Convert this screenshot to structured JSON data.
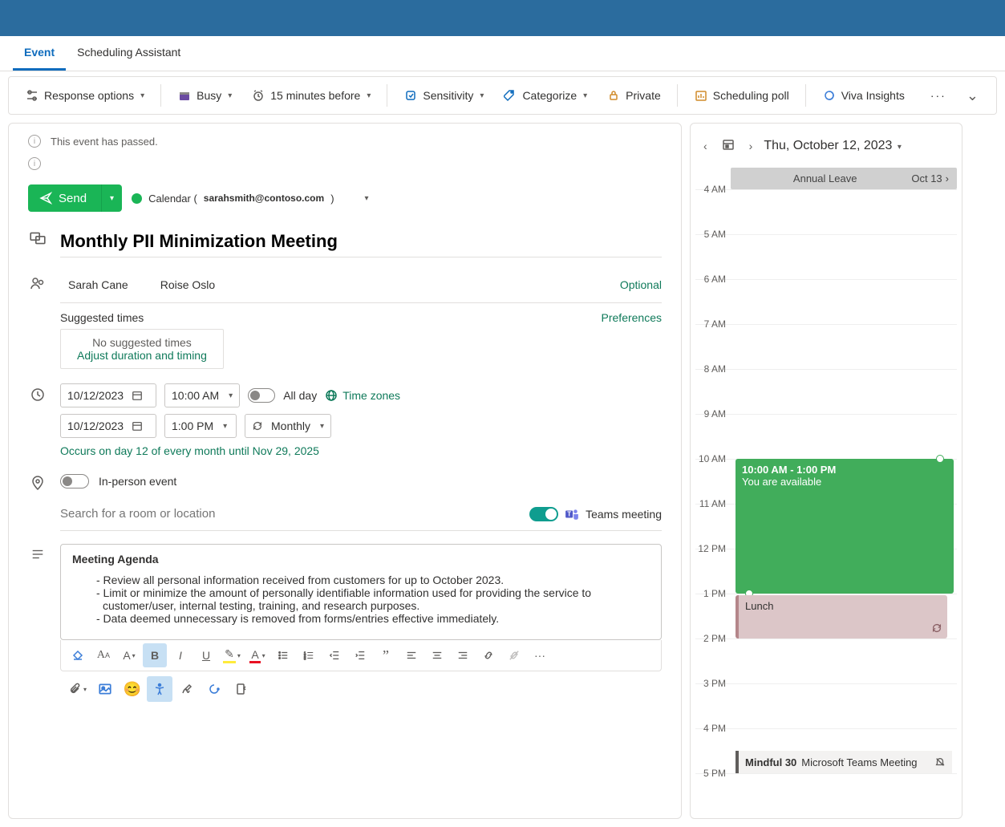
{
  "tabs": {
    "event": "Event",
    "scheduling": "Scheduling Assistant"
  },
  "ribbon": {
    "response": "Response options",
    "busy": "Busy",
    "reminder": "15 minutes before",
    "sensitivity": "Sensitivity",
    "categorize": "Categorize",
    "private": "Private",
    "poll": "Scheduling poll",
    "viva": "Viva Insights"
  },
  "banner": {
    "passed": "This event has passed."
  },
  "send": {
    "label": "Send"
  },
  "calendar_owner": {
    "prefix": "Calendar (",
    "email": "sarahsmith@contoso.com",
    "suffix": ")"
  },
  "event_title": "Monthly PII Minimization Meeting",
  "attendees": [
    "Sarah Cane",
    "Roise Oslo"
  ],
  "optional_label": "Optional",
  "suggested": {
    "label": "Suggested times",
    "prefs": "Preferences",
    "none": "No suggested times",
    "adjust": "Adjust duration and timing"
  },
  "datetime": {
    "start_date": "10/12/2023",
    "start_time": "10:00 AM",
    "end_date": "10/12/2023",
    "end_time": "1:00 PM",
    "all_day": "All day",
    "timezones": "Time zones",
    "recurrence": "Monthly",
    "recurrence_text": "Occurs on day 12 of every month until Nov 29, 2025"
  },
  "location": {
    "in_person": "In-person event",
    "placeholder": "Search for a room or location",
    "teams": "Teams meeting"
  },
  "body": {
    "heading": "Meeting Agenda",
    "lines": [
      "- Review all personal information received from customers for up to October 2023.",
      "- Limit or minimize the amount of personally identifiable information used for providing the service to customer/user, internal testing, training, and research purposes.",
      "- Data deemed unnecessary is removed from forms/entries effective immediately."
    ]
  },
  "calendar": {
    "date_label": "Thu, October 12, 2023",
    "annual_leave": "Annual Leave",
    "annual_date": "Oct 13",
    "hours": [
      "4 AM",
      "5 AM",
      "6 AM",
      "7 AM",
      "8 AM",
      "9 AM",
      "10 AM",
      "11 AM",
      "12 PM",
      "1 PM",
      "2 PM",
      "3 PM",
      "4 PM",
      "5 PM"
    ],
    "current_event_time": "10:00 AM - 1:00 PM",
    "current_event_status": "You are available",
    "lunch": "Lunch",
    "mindful_title": "Mindful 30",
    "mindful_sub": "Microsoft Teams Meeting"
  }
}
